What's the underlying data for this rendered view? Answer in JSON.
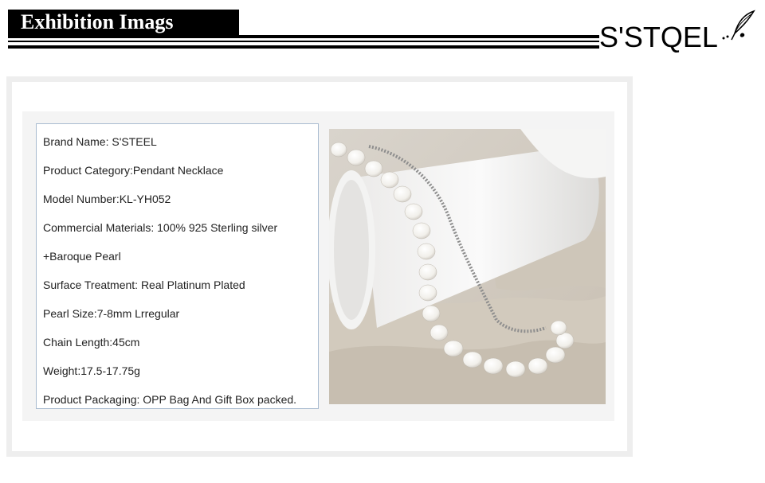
{
  "header": {
    "title": "Exhibition Imags",
    "logo_text": "S'STQEL"
  },
  "specs": [
    "Brand Name: S'STEEL",
    "Product Category:Pendant Necklace",
    "Model Number:KL-YH052",
    "Commercial Materials: 100% 925 Sterling silver",
    "+Baroque Pearl",
    "Surface Treatment: Real Platinum Plated",
    "Pearl Size:7-8mm Lrregular",
    "Chain Length:45cm",
    "Weight:17.5-17.75g",
    "Product Packaging: OPP Bag And Gift Box packed."
  ],
  "colors": {
    "header_bg": "#000000",
    "frame": "#eeeeee",
    "panel": "#f4f4f4",
    "spec_border": "#a9bcd0"
  },
  "icons": {
    "logo_mark": "feather-quill-icon"
  }
}
